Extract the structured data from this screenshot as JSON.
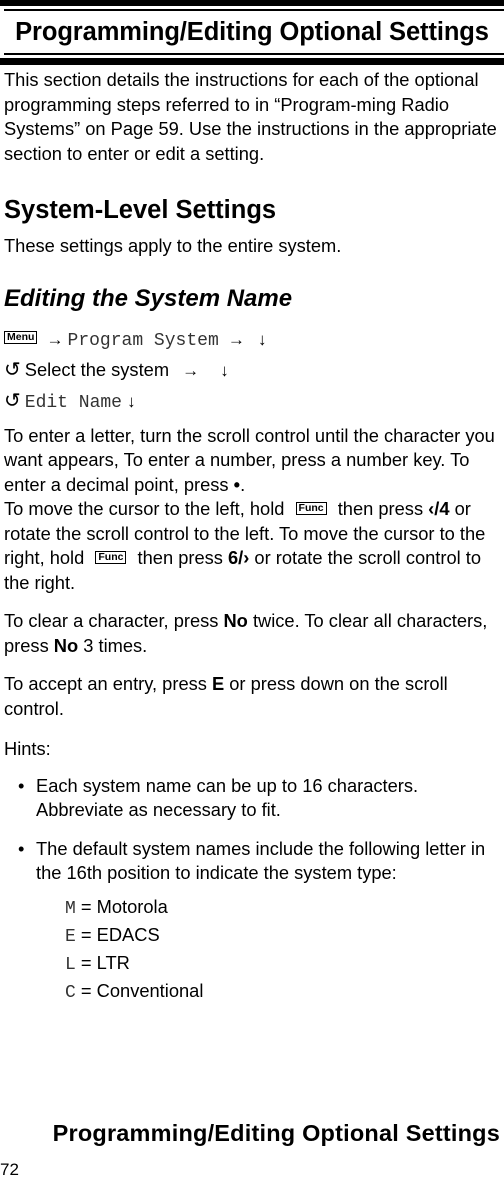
{
  "header": {
    "title": "Programming/Editing Optional Settings"
  },
  "intro": "This section details the instructions for each of the optional programming steps referred to in “Program-ming Radio Systems” on Page 59. Use the instructions in the appropriate section to enter or edit a setting.",
  "section": {
    "title": "System-Level Settings",
    "description": "These settings apply to the entire system."
  },
  "subsection": {
    "title": "Editing the System Name"
  },
  "steps": {
    "menu_key": "Menu",
    "program_system": "Program System",
    "select_system": "Select the system",
    "edit_name": "Edit Name",
    "arrow_right": "→",
    "arrow_down": "↓",
    "rotate": "↺"
  },
  "instructions": {
    "p1_a": "To enter a letter, turn the scroll control until the character you want appears, To enter a number, press a number key. To enter a decimal point, press ",
    "decimal_key": "•",
    "p1_b": ".",
    "p1_c": "To move the cursor to the left, hold ",
    "func_key": "Func",
    "p1_d": " then press ",
    "left_key": "‹/4",
    "p1_e": " or rotate the scroll control to the left. To move the cursor to the right, hold ",
    "p1_f": " then press ",
    "right_key": "6/›",
    "p1_g": " or rotate the scroll control to the right."
  },
  "clear": {
    "a": "To clear a character, press ",
    "no_key": "No",
    "b": " twice. To clear all characters, press ",
    "c": " 3 times."
  },
  "accept": {
    "a": "To accept an entry, press ",
    "e_key": "E",
    "b": " or press down on the scroll control."
  },
  "hints": {
    "label": "Hints:",
    "bullet": "•",
    "items": [
      "Each system name can be up to 16 characters. Abbreviate as necessary to fit.",
      "The default system names include the following letter in the 16th position to indicate the system type:"
    ],
    "types": [
      {
        "code": "M",
        "name": "= Motorola"
      },
      {
        "code": "E",
        "name": "= EDACS"
      },
      {
        "code": "L",
        "name": "= LTR"
      },
      {
        "code": "C",
        "name": "= Conventional"
      }
    ]
  },
  "footer": {
    "title": "Programming/Editing Optional Settings",
    "page_number": "72"
  }
}
